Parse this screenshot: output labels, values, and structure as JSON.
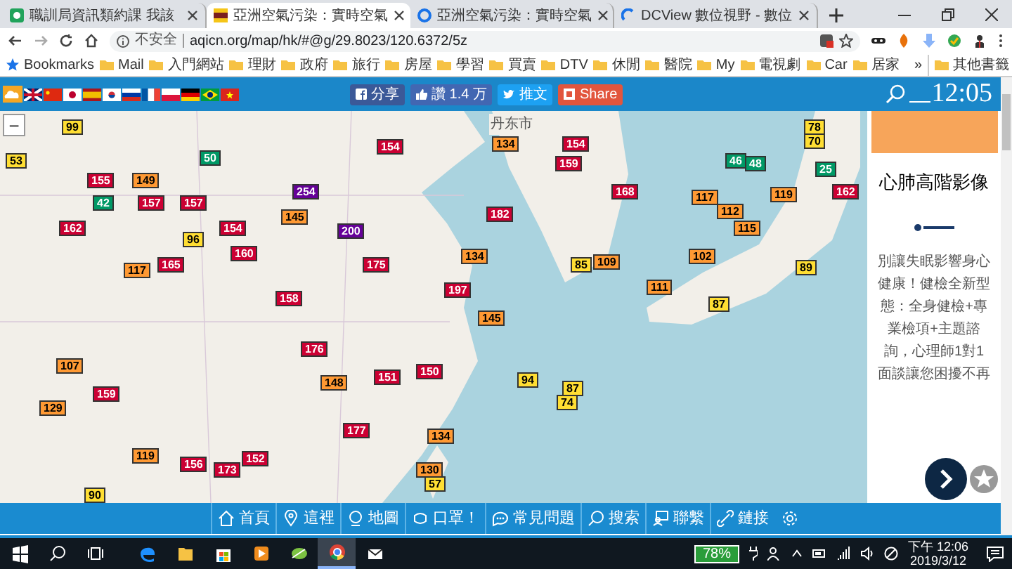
{
  "browser": {
    "tabs": [
      {
        "title": "職訓局資訊類約課 我該",
        "selected": false
      },
      {
        "title": "亞洲空氣污染：實時空氣",
        "selected": true
      },
      {
        "title": "亞洲空氣污染：實時空氣",
        "selected": false
      },
      {
        "title": "DCView 數位視野 - 數位",
        "selected": false
      }
    ],
    "address_bar": {
      "security": "不安全",
      "url": "aqicn.org/map/hk/#@g/29.8023/120.6372/5z"
    },
    "bookmarks": [
      "Bookmarks",
      "Mail",
      "入門網站",
      "理財",
      "政府",
      "旅行",
      "房屋",
      "學習",
      "買賣",
      "DTV",
      "休閒",
      "醫院",
      "My",
      "電視劇",
      "Car",
      "居家"
    ],
    "overflow": "»",
    "other_bookmarks": "其他書籤"
  },
  "site_header": {
    "share_buttons": [
      {
        "kind": "facebook",
        "label": "分享"
      },
      {
        "kind": "like",
        "label": "讚 1.4 万"
      },
      {
        "kind": "twitter",
        "label": "推文"
      },
      {
        "kind": "share",
        "label": "Share"
      }
    ],
    "clock": "12:05"
  },
  "map": {
    "zoom_out": "−",
    "place_labels": [
      "丹东市"
    ],
    "markers": [
      {
        "value": "53",
        "color": "#ffde33"
      },
      {
        "value": "99",
        "color": "#ffde33"
      },
      {
        "value": "155",
        "color": "#cc0033"
      },
      {
        "value": "149",
        "color": "#ff9933"
      },
      {
        "value": "42",
        "color": "#009966"
      },
      {
        "value": "157",
        "color": "#cc0033"
      },
      {
        "value": "157",
        "color": "#cc0033"
      },
      {
        "value": "50",
        "color": "#009966"
      },
      {
        "value": "162",
        "color": "#cc0033"
      },
      {
        "value": "117",
        "color": "#ff9933"
      },
      {
        "value": "165",
        "color": "#cc0033"
      },
      {
        "value": "154",
        "color": "#cc0033"
      },
      {
        "value": "160",
        "color": "#cc0033"
      },
      {
        "value": "96",
        "color": "#ffde33"
      },
      {
        "value": "254",
        "color": "#660099"
      },
      {
        "value": "200",
        "color": "#660099"
      },
      {
        "value": "145",
        "color": "#ff9933"
      },
      {
        "value": "154",
        "color": "#cc0033"
      },
      {
        "value": "134",
        "color": "#ff9933"
      },
      {
        "value": "182",
        "color": "#cc0033"
      },
      {
        "value": "134",
        "color": "#ff9933"
      },
      {
        "value": "154",
        "color": "#cc0033"
      },
      {
        "value": "159",
        "color": "#cc0033"
      },
      {
        "value": "168",
        "color": "#cc0033"
      },
      {
        "value": "117",
        "color": "#ff9933"
      },
      {
        "value": "112",
        "color": "#ff9933"
      },
      {
        "value": "85",
        "color": "#ffde33"
      },
      {
        "value": "109",
        "color": "#ff9933"
      },
      {
        "value": "102",
        "color": "#ff9933"
      },
      {
        "value": "111",
        "color": "#ff9933"
      },
      {
        "value": "175",
        "color": "#cc0033"
      },
      {
        "value": "158",
        "color": "#cc0033"
      },
      {
        "value": "197",
        "color": "#cc0033"
      },
      {
        "value": "145",
        "color": "#ff9933"
      },
      {
        "value": "176",
        "color": "#cc0033"
      },
      {
        "value": "107",
        "color": "#ff9933"
      },
      {
        "value": "159",
        "color": "#cc0033"
      },
      {
        "value": "129",
        "color": "#ff9933"
      },
      {
        "value": "148",
        "color": "#ff9933"
      },
      {
        "value": "151",
        "color": "#cc0033"
      },
      {
        "value": "150",
        "color": "#cc0033"
      },
      {
        "value": "94",
        "color": "#ffde33"
      },
      {
        "value": "87",
        "color": "#ffde33"
      },
      {
        "value": "74",
        "color": "#ffde33"
      },
      {
        "value": "119",
        "color": "#ff9933"
      },
      {
        "value": "156",
        "color": "#cc0033"
      },
      {
        "value": "152",
        "color": "#cc0033"
      },
      {
        "value": "173",
        "color": "#cc0033"
      },
      {
        "value": "177",
        "color": "#cc0033"
      },
      {
        "value": "134",
        "color": "#ff9933"
      },
      {
        "value": "130",
        "color": "#ff9933"
      },
      {
        "value": "90",
        "color": "#ffde33"
      },
      {
        "value": "57",
        "color": "#ffde33"
      },
      {
        "value": "78",
        "color": "#ffde33"
      },
      {
        "value": "70",
        "color": "#ffde33"
      },
      {
        "value": "46",
        "color": "#009966"
      },
      {
        "value": "48",
        "color": "#009966"
      },
      {
        "value": "25",
        "color": "#009966"
      },
      {
        "value": "119",
        "color": "#ff9933"
      },
      {
        "value": "162",
        "color": "#cc0033"
      },
      {
        "value": "115",
        "color": "#ff9933"
      },
      {
        "value": "89",
        "color": "#ffde33"
      },
      {
        "value": "87",
        "color": "#ffde33"
      }
    ]
  },
  "ad": {
    "title": "心肺高階影像",
    "body": "別讓失眠影響身心健康！健檢全新型態：全身健檢+專業檢項+主題諮詢，心理師1對1面談讓您困擾不再"
  },
  "bottom_nav": [
    {
      "label": "首頁"
    },
    {
      "label": "這裡"
    },
    {
      "label": "地圖"
    },
    {
      "label": "口罩！"
    },
    {
      "label": "常見問題"
    },
    {
      "label": "搜索"
    },
    {
      "label": "聯繫"
    },
    {
      "label": "鏈接"
    }
  ],
  "taskbar": {
    "battery": "78%",
    "time": "下午 12:06",
    "date": "2019/3/12"
  }
}
